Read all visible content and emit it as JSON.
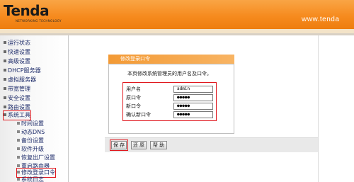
{
  "header": {
    "logo_text": "Tenda",
    "logo_tagline": "NETWORKING TECHNOLOGY",
    "url": "www.tenda"
  },
  "sidebar": {
    "items": [
      {
        "label": "运行状态"
      },
      {
        "label": "快速设置"
      },
      {
        "label": "高级设置"
      },
      {
        "label": "DHCP服务器"
      },
      {
        "label": "虚拟服务器"
      },
      {
        "label": "带宽管理"
      },
      {
        "label": "安全设置"
      },
      {
        "label": "路由设置"
      },
      {
        "label": "系统工具",
        "selected": true
      }
    ],
    "sub_items": [
      {
        "label": "时间设置"
      },
      {
        "label": "动态DNS"
      },
      {
        "label": "备份设置"
      },
      {
        "label": "软件升级"
      },
      {
        "label": "恢复出厂设置"
      },
      {
        "label": "重启路由器"
      },
      {
        "label": "修改登录口令",
        "selected": true
      },
      {
        "label": "系统日志"
      }
    ]
  },
  "panel": {
    "title": "修改登录口令",
    "description": "本页修改系统管理员的用户名及口令。",
    "fields": [
      {
        "label": "用户名",
        "value": "admin"
      },
      {
        "label": "原口令",
        "value": "●●●●●"
      },
      {
        "label": "新口令",
        "value": "●●●●●"
      },
      {
        "label": "确认新口令",
        "value": "●●●●●"
      }
    ]
  },
  "buttons": {
    "save": "保 存",
    "restore": "还 原",
    "help": "帮 助"
  },
  "colors": {
    "brand_orange": "#f68b1f",
    "highlight_red": "#e0181e",
    "nav_text": "#1f2d6b"
  }
}
